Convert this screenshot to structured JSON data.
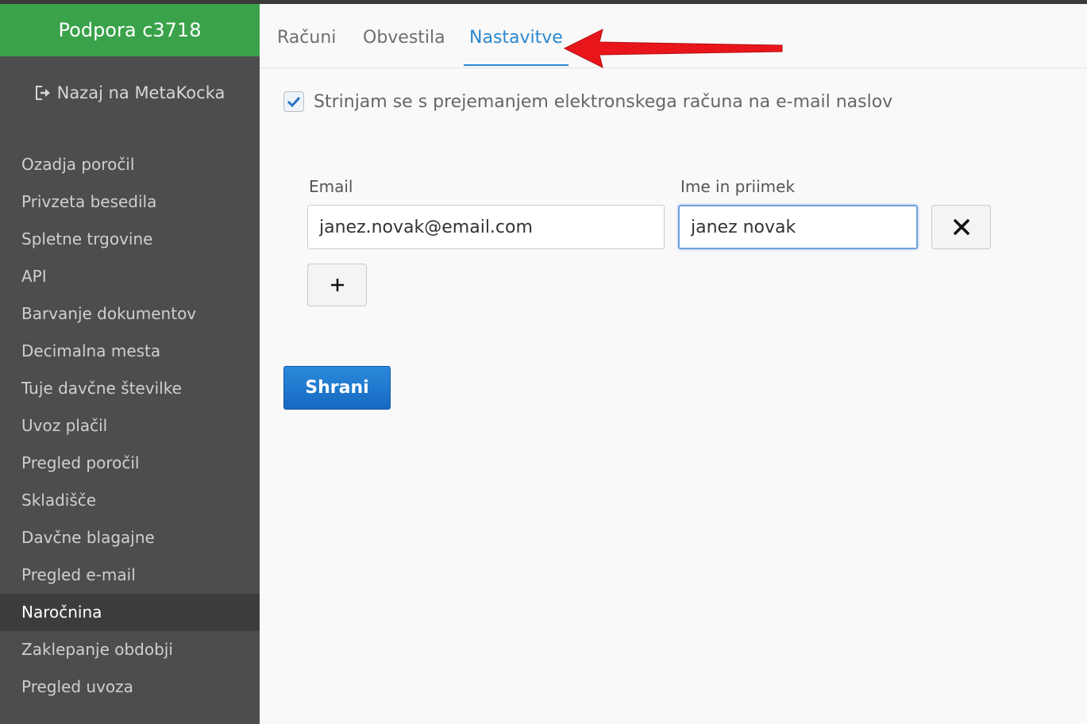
{
  "sidebar": {
    "brand": "Podpora c3718",
    "back_link": {
      "label": "Nazaj na MetaKocka",
      "icon": "sign-out-icon"
    },
    "items": [
      {
        "label": "Ozadja poročil",
        "active": false
      },
      {
        "label": "Privzeta besedila",
        "active": false
      },
      {
        "label": "Spletne trgovine",
        "active": false
      },
      {
        "label": "API",
        "active": false
      },
      {
        "label": "Barvanje dokumentov",
        "active": false
      },
      {
        "label": "Decimalna mesta",
        "active": false
      },
      {
        "label": "Tuje davčne številke",
        "active": false
      },
      {
        "label": "Uvoz plačil",
        "active": false
      },
      {
        "label": "Pregled poročil",
        "active": false
      },
      {
        "label": "Skladišče",
        "active": false
      },
      {
        "label": "Davčne blagajne",
        "active": false
      },
      {
        "label": "Pregled e-mail",
        "active": false
      },
      {
        "label": "Naročnina",
        "active": true
      },
      {
        "label": "Zaklepanje obdobji",
        "active": false
      },
      {
        "label": "Pregled uvoza",
        "active": false
      }
    ]
  },
  "tabs": [
    {
      "label": "Računi",
      "active": false
    },
    {
      "label": "Obvestila",
      "active": false
    },
    {
      "label": "Nastavitve",
      "active": true
    }
  ],
  "settings": {
    "consent_label": "Strinjam se s prejemanjem elektronskega računa na e-mail naslov",
    "consent_checked": true,
    "email_label": "Email",
    "email_value": "janez.novak@email.com",
    "name_label": "Ime in priimek",
    "name_value": "janez novak",
    "remove_icon": "close-icon",
    "add_icon": "plus-icon",
    "save_label": "Shrani"
  },
  "colors": {
    "brand_green": "#3aa24a",
    "sidebar_bg": "#4d4d4d",
    "active_tab": "#2a87cf",
    "primary_button": "#1a73cc",
    "annotation_arrow": "#e8161b"
  }
}
